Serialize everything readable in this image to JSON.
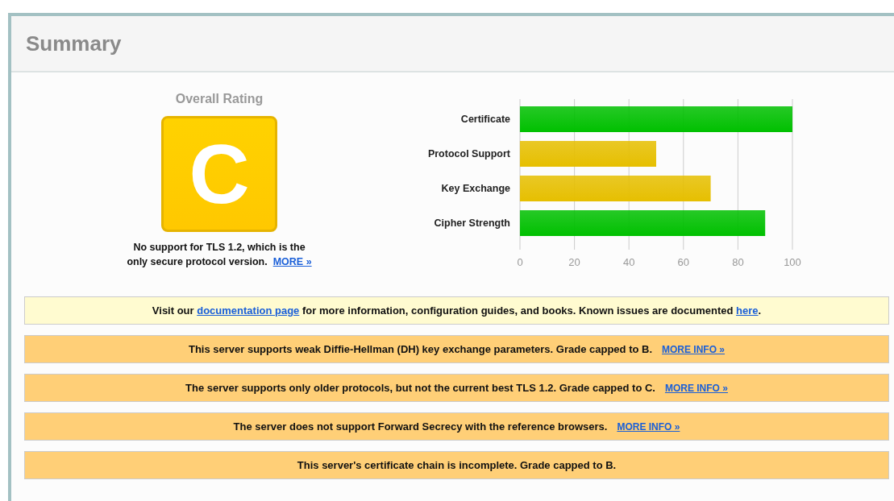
{
  "title": "Summary",
  "rating": {
    "heading": "Overall Rating",
    "grade": "C",
    "note_lines": [
      "No support for TLS 1.2, which is the",
      "only secure protocol version."
    ],
    "note_link": "MORE »"
  },
  "chart_data": {
    "type": "bar",
    "orientation": "horizontal",
    "categories": [
      "Certificate",
      "Protocol Support",
      "Key Exchange",
      "Cipher Strength"
    ],
    "series": [
      {
        "values": [
          100,
          50,
          70,
          90
        ]
      }
    ],
    "grid": true,
    "colors": [
      "#00c000",
      "#e6bf00",
      "#e6bf00",
      "#00c000"
    ],
    "xlim": [
      0,
      100
    ],
    "xticks": [
      0,
      20,
      40,
      60,
      80,
      100
    ]
  },
  "notices": [
    {
      "kind": "info",
      "parts": [
        {
          "kind": "text",
          "text": "Visit our "
        },
        {
          "kind": "link",
          "text": "documentation page"
        },
        {
          "kind": "text",
          "text": " for more information, configuration guides, and books. Known issues are documented "
        },
        {
          "kind": "link",
          "text": "here"
        },
        {
          "kind": "text",
          "text": "."
        }
      ]
    },
    {
      "kind": "warning",
      "text": "This server supports weak Diffie-Hellman (DH) key exchange parameters. Grade capped to B.",
      "link": "MORE INFO »"
    },
    {
      "kind": "warning",
      "text": "The server supports only older protocols, but not the current best TLS 1.2. Grade capped to C.",
      "link": "MORE INFO »"
    },
    {
      "kind": "warning",
      "text": "The server does not support Forward Secrecy with the reference browsers.",
      "link": "MORE INFO »"
    },
    {
      "kind": "warning",
      "text": "This server's certificate chain is incomplete. Grade capped to B."
    }
  ]
}
